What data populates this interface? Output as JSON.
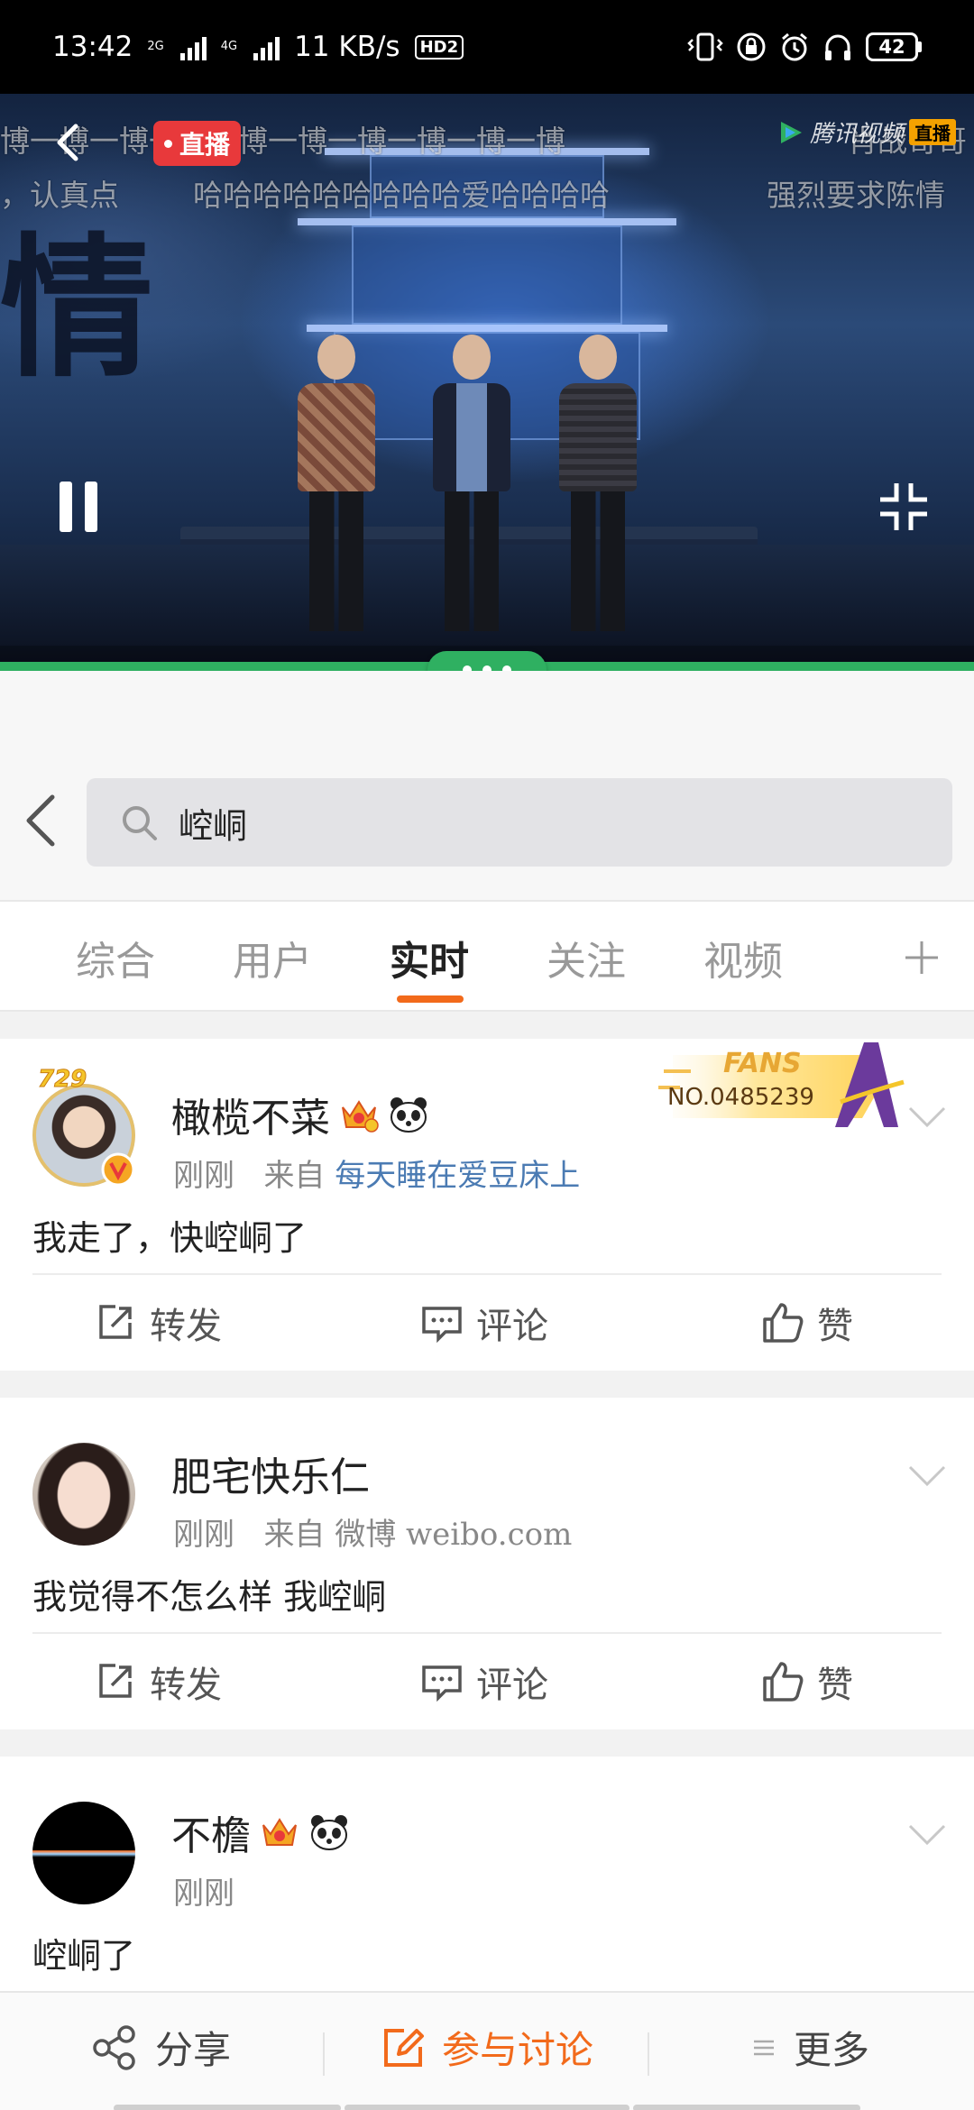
{
  "status_bar": {
    "time": "13:42",
    "net1": "2G",
    "net2": "4G",
    "speed": "11 KB/s",
    "hd": "HD2",
    "battery": "42"
  },
  "video": {
    "live_label": "直播",
    "logo_text": "腾讯视频",
    "logo_live": "直播",
    "danmaku": [
      "博一博一博一博一博一博一博一博一博一博",
      "，认真点",
      "哈哈哈哈哈哈哈哈哈爱哈哈哈哈",
      "强烈要求陈情",
      "肖战哥哥"
    ],
    "calligraphy": "情",
    "progress": 1.0
  },
  "search": {
    "query": "崆峒"
  },
  "tabs": {
    "items": [
      "综合",
      "用户",
      "实时",
      "关注",
      "视频"
    ],
    "active_index": 2
  },
  "posts": [
    {
      "username": "橄榄不菜",
      "time": "刚刚",
      "source_prefix": "来自",
      "source": "每天睡在爱豆床上",
      "source_is_link": true,
      "content": "我走了，快崆峒了",
      "fans_label": "FANS",
      "fans_no": "NO.0485239",
      "avatar_badge": "729"
    },
    {
      "username": "肥宅快乐仁",
      "time": "刚刚",
      "source_prefix": "来自",
      "source": "微博 weibo.com",
      "source_is_link": false,
      "content": "我觉得不怎么样 我崆峒"
    },
    {
      "username": "不檐",
      "time": "刚刚",
      "content": "崆峒了"
    }
  ],
  "actions": {
    "repost": "转发",
    "comment": "评论",
    "like": "赞"
  },
  "bottom_bar": {
    "share": "分享",
    "join": "参与讨论",
    "more": "更多"
  },
  "colors": {
    "accent_orange": "#f26a1b",
    "live_red": "#e8393b",
    "progress_green": "#2fb061",
    "link_blue": "#4b7bb3"
  }
}
